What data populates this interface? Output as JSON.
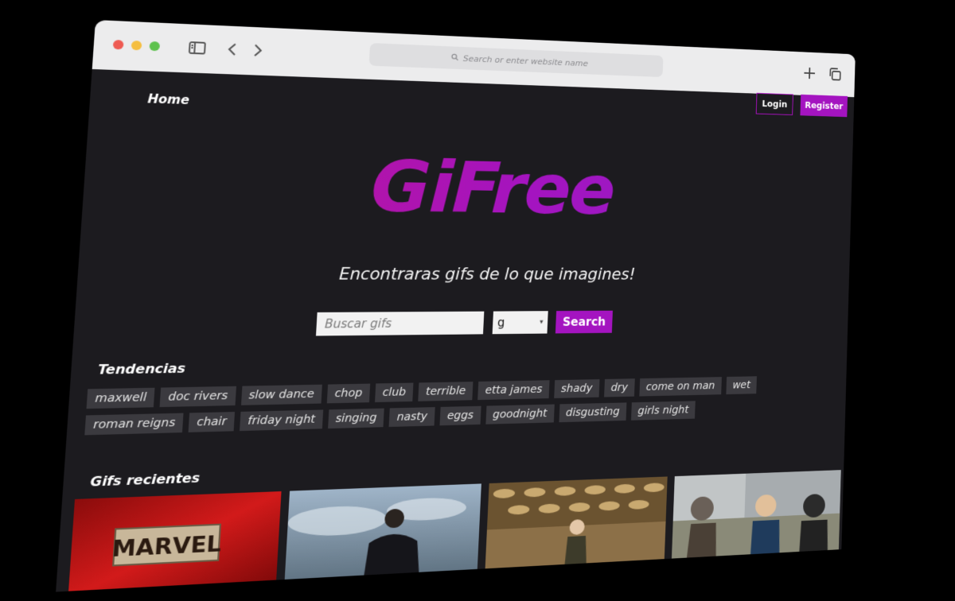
{
  "browser": {
    "address_placeholder": "Search or enter website name"
  },
  "nav": {
    "home": "Home",
    "login": "Login",
    "register": "Register"
  },
  "hero": {
    "logo": "GiFree",
    "tagline": "Encontraras gifs de lo que imagines!"
  },
  "search": {
    "placeholder": "Buscar gifs",
    "rating_value": "g",
    "button": "Search"
  },
  "trending": {
    "title": "Tendencias",
    "tags": [
      "maxwell",
      "doc rivers",
      "slow dance",
      "chop",
      "club",
      "terrible",
      "etta james",
      "shady",
      "dry",
      "come on man",
      "wet",
      "roman reigns",
      "chair",
      "friday night",
      "singing",
      "nasty",
      "eggs",
      "goodnight",
      "disgusting",
      "girls night"
    ]
  },
  "recent": {
    "title": "Gifs recientes",
    "gifs": [
      {
        "name": "marvel-gif",
        "text": "MARVEL"
      },
      {
        "name": "black-panther-gif"
      },
      {
        "name": "loki-gif"
      },
      {
        "name": "street-scene-gif"
      }
    ]
  },
  "colors": {
    "accent": "#a414c0",
    "logo_start": "#c4138a",
    "logo_end": "#8d22c8",
    "page_bg": "#1c1b1f",
    "tag_bg": "#3b3a3f"
  }
}
